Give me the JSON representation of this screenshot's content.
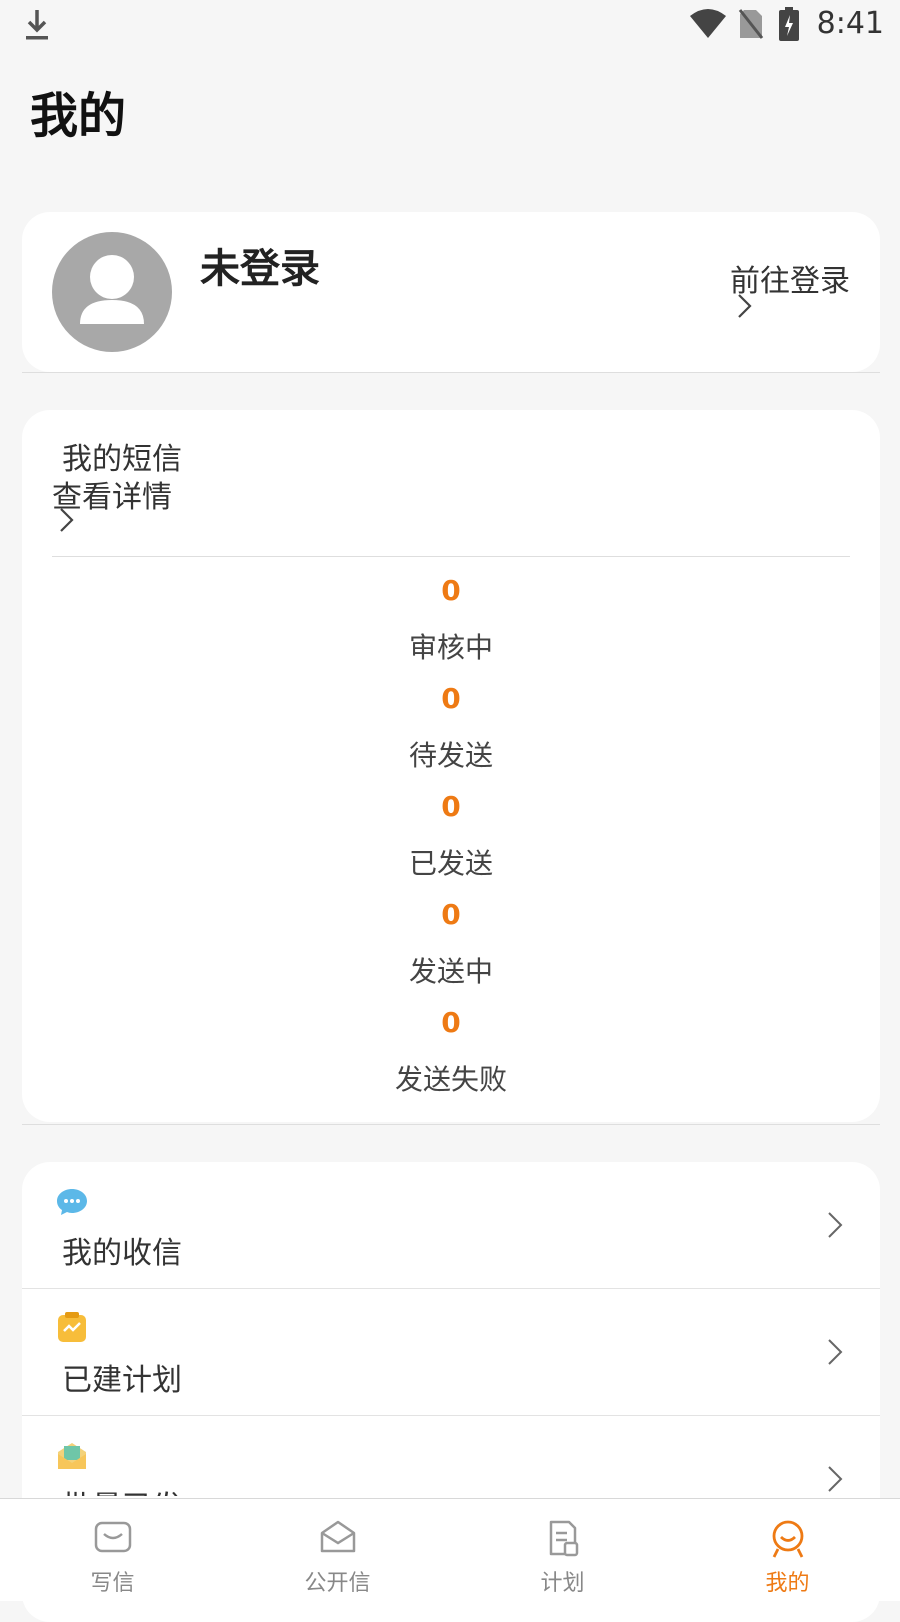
{
  "status_bar": {
    "time": "8:41"
  },
  "header": {
    "title": "我的"
  },
  "profile": {
    "name": "未登录",
    "login_label": "前往登录"
  },
  "sms": {
    "title": "我的短信",
    "detail_label": "查看详情",
    "stats": [
      {
        "count": "0",
        "label": "审核中"
      },
      {
        "count": "0",
        "label": "待发送"
      },
      {
        "count": "0",
        "label": "已发送"
      },
      {
        "count": "0",
        "label": "发送中"
      },
      {
        "count": "0",
        "label": "发送失败"
      }
    ]
  },
  "menu": {
    "items": [
      {
        "label": "我的收信",
        "icon": "chat-bubble-icon"
      },
      {
        "label": "已建计划",
        "icon": "clipboard-icon"
      },
      {
        "label": "批量已发",
        "icon": "envelope-icon"
      }
    ]
  },
  "bottom_nav": {
    "items": [
      {
        "label": "写信",
        "icon": "mail-icon"
      },
      {
        "label": "公开信",
        "icon": "open-envelope-icon"
      },
      {
        "label": "计划",
        "icon": "document-icon"
      },
      {
        "label": "我的",
        "icon": "user-icon"
      }
    ],
    "active_index": 3
  },
  "colors": {
    "accent": "#ee7a14",
    "avatar": "#a8a8a8"
  }
}
